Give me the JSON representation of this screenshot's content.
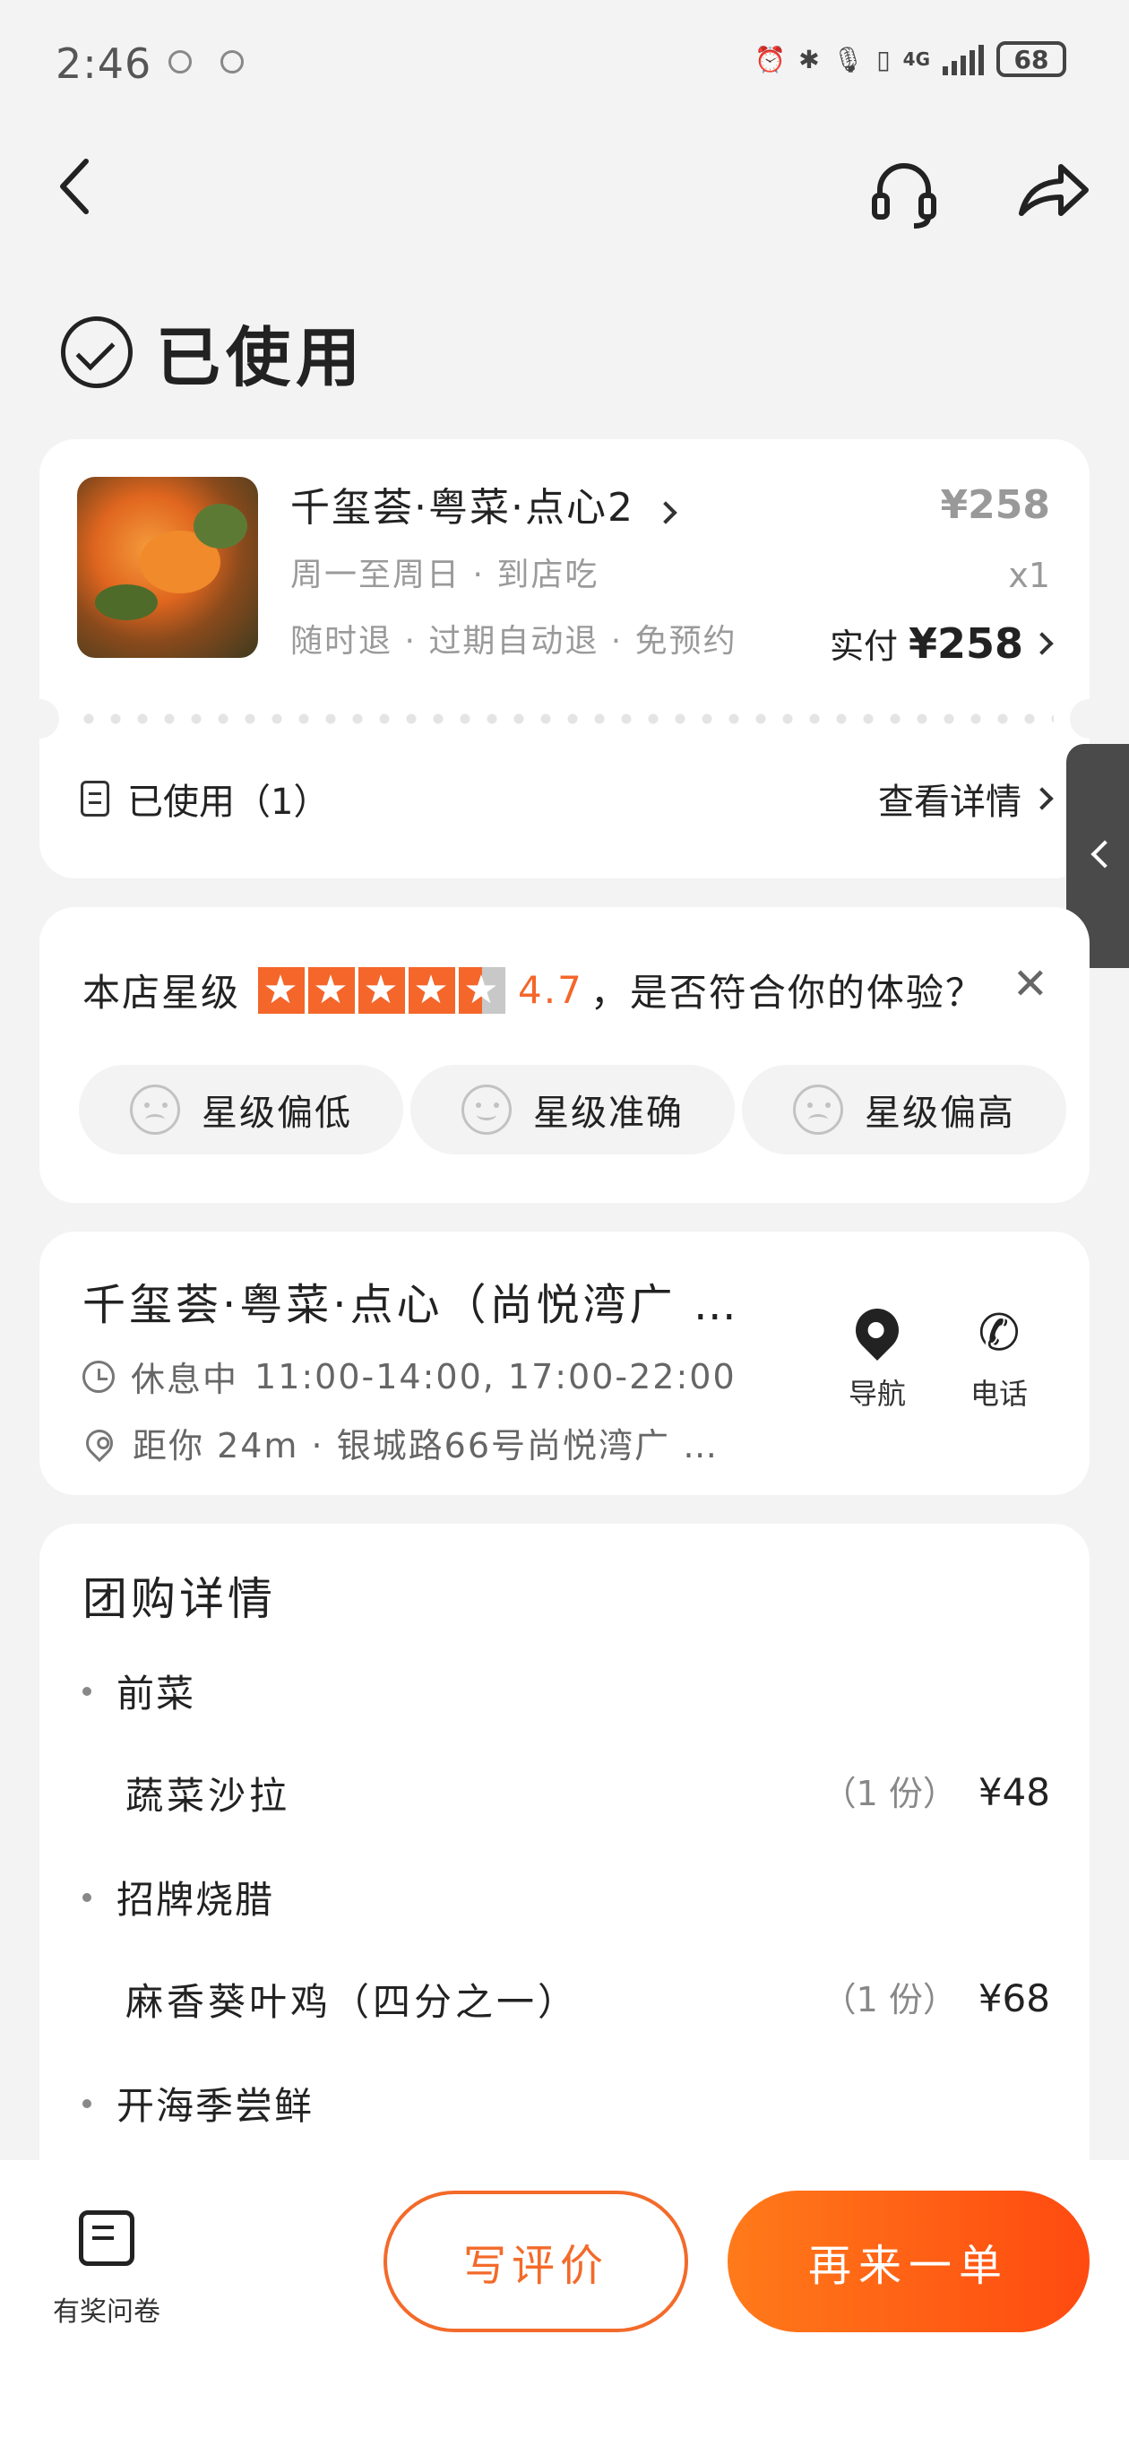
{
  "status_bar": {
    "time": "2:46",
    "network": "4G",
    "battery": "68"
  },
  "header": {
    "status": "已使用"
  },
  "order": {
    "product_name": "千玺荟·粤菜·点心2",
    "line1": "周一至周日 · 到店吃",
    "line2": "随时退 · 过期自动退 · 免预约",
    "price": "¥258",
    "quantity": "x1",
    "paid_label": "实付",
    "paid_amount": "¥258",
    "used_label": "已使用（1）",
    "detail_link": "查看详情"
  },
  "rating": {
    "prefix": "本店星级",
    "stars": 4.7,
    "score": "4.7",
    "question": "，是否符合你的体验？",
    "close": "✕",
    "chips": [
      "星级偏低",
      "星级准确",
      "星级偏高"
    ]
  },
  "store": {
    "name": "千玺荟·粤菜·点心（尚悦湾广 …",
    "status": "休息中",
    "hours": "11:00-14:00, 17:00-22:00",
    "distance": "距你 24m · 银城路66号尚悦湾广 …",
    "nav_label": "导航",
    "phone_label": "电话"
  },
  "group": {
    "title": "团购详情",
    "sections": [
      {
        "category": "前菜",
        "items": [
          {
            "name": "蔬菜沙拉",
            "portion": "（1 份）",
            "price": "¥48"
          }
        ]
      },
      {
        "category": "招牌烧腊",
        "items": [
          {
            "name": "麻香葵叶鸡（四分之一）",
            "portion": "（1 份）",
            "price": "¥68"
          }
        ]
      },
      {
        "category": "开海季尝鲜",
        "items": []
      }
    ]
  },
  "bottom": {
    "survey_label": "有奖问卷",
    "review_button": "写评价",
    "reorder_button": "再来一单"
  },
  "colors": {
    "accent": "#f4662a",
    "background": "#f3f3f3"
  }
}
